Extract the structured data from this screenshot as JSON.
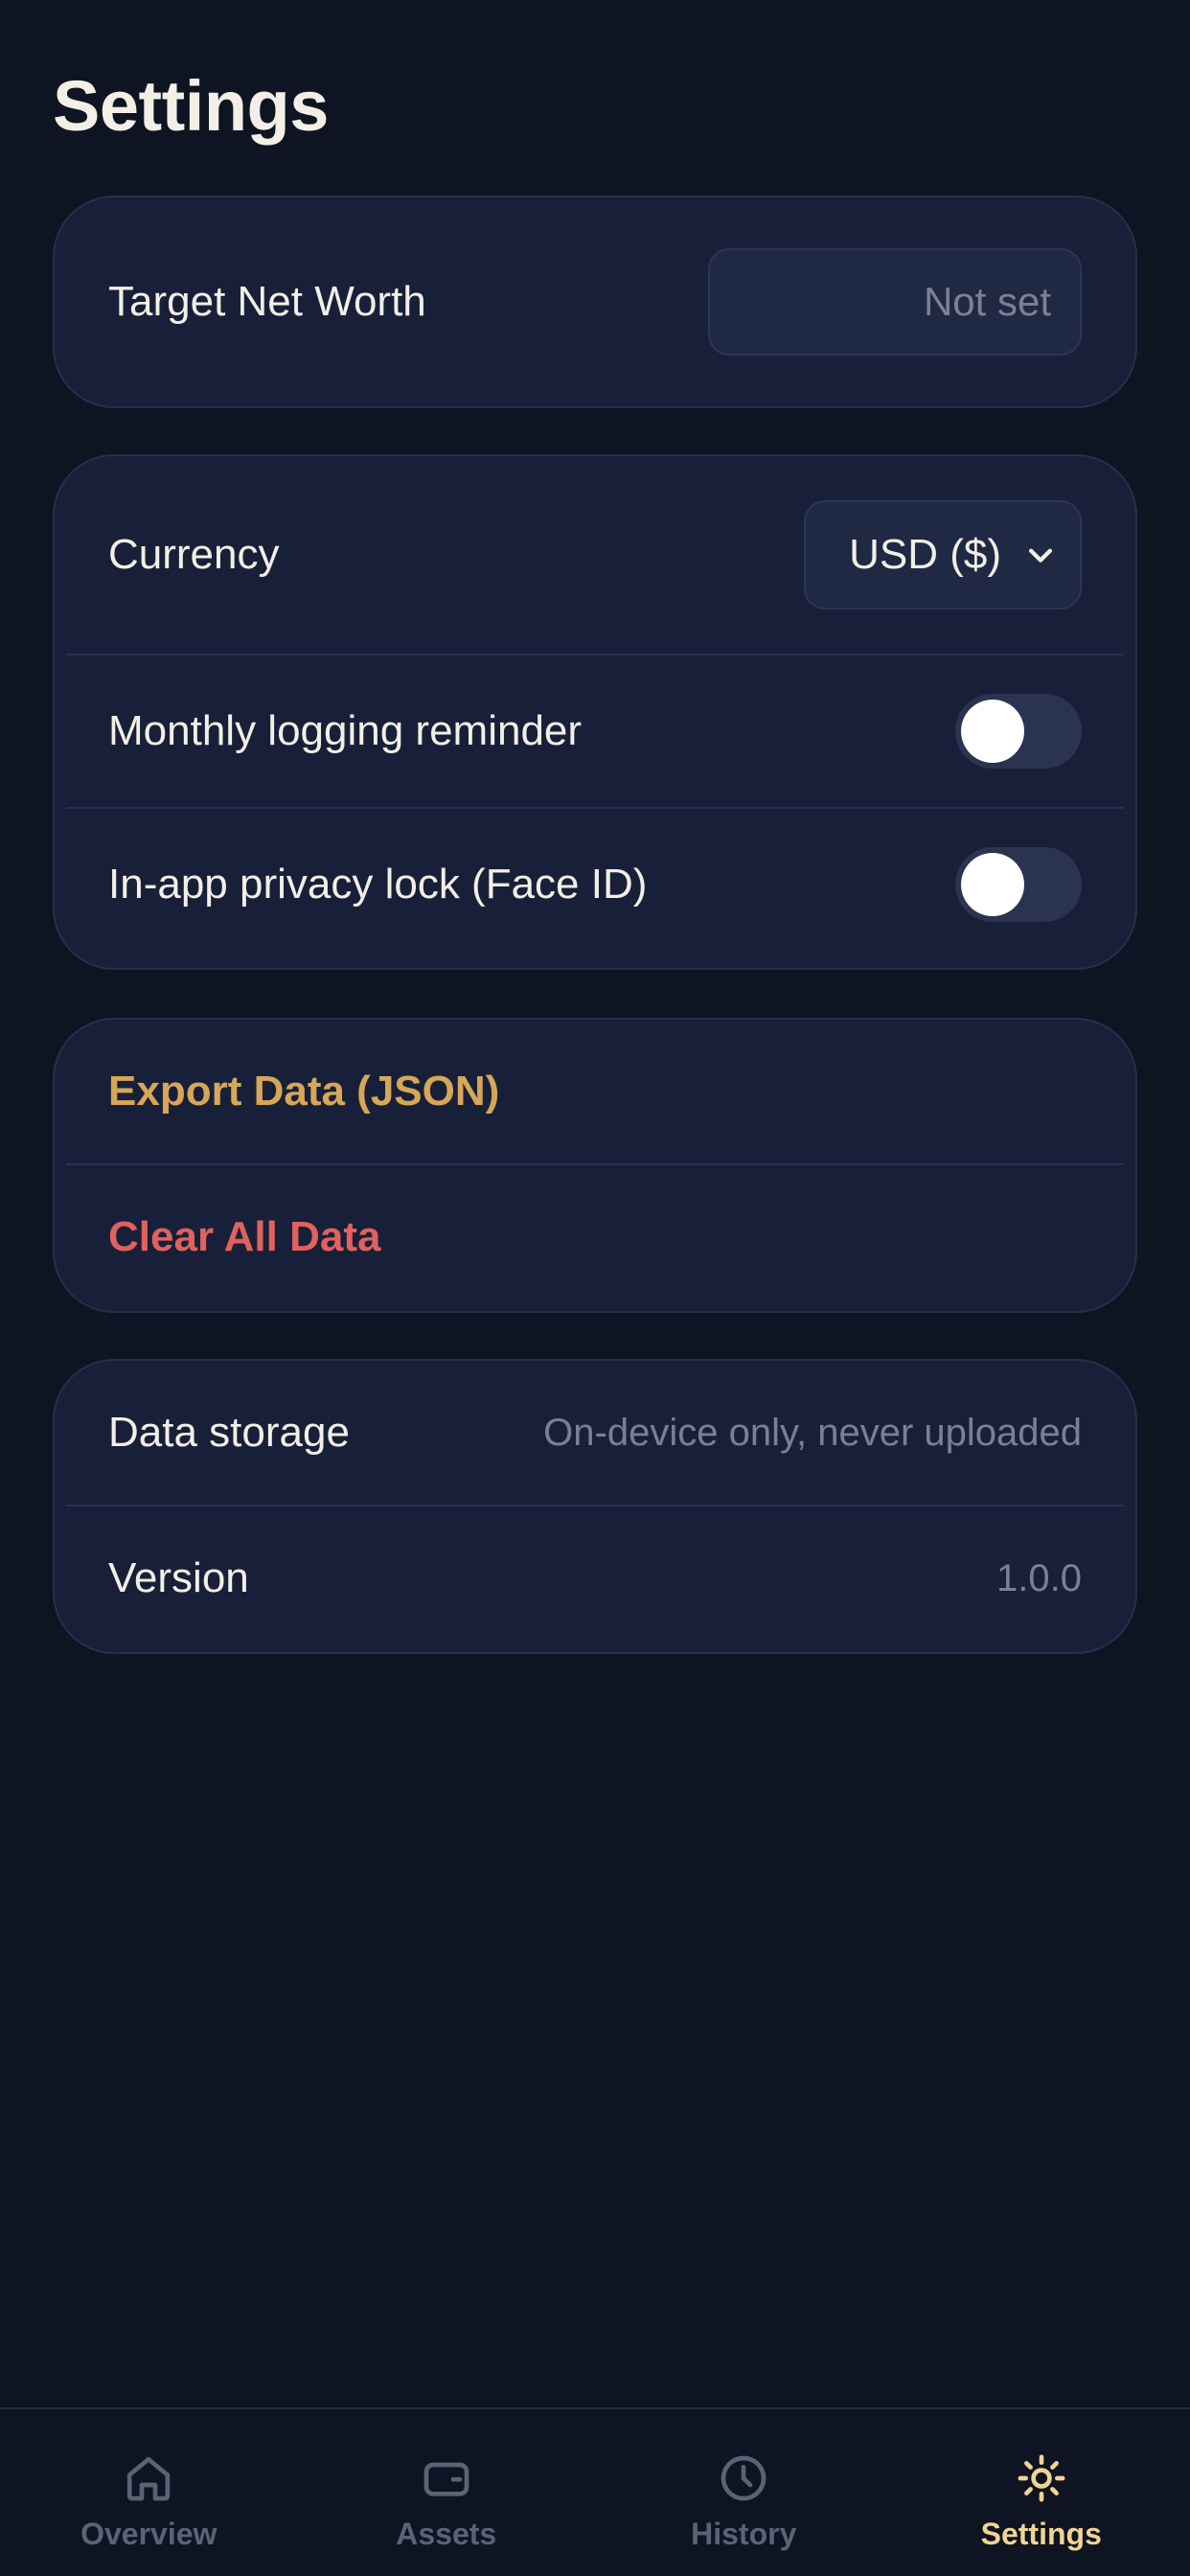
{
  "header": {
    "title": "Settings"
  },
  "target": {
    "label": "Target Net Worth",
    "value": "",
    "placeholder": "Not set"
  },
  "preferences": {
    "currency_label": "Currency",
    "currency_value": "USD ($)",
    "reminder_label": "Monthly logging reminder",
    "reminder_on": false,
    "privacy_label": "In-app privacy lock (Face ID)",
    "privacy_on": false
  },
  "actions": {
    "export_label": "Export Data (JSON)",
    "clear_label": "Clear All Data"
  },
  "info": {
    "storage_label": "Data storage",
    "storage_value": "On-device only, never uploaded",
    "version_label": "Version",
    "version_value": "1.0.0"
  },
  "tabbar": {
    "active": "Settings",
    "items": [
      {
        "label": "Overview",
        "icon": "home-icon"
      },
      {
        "label": "Assets",
        "icon": "wallet-icon"
      },
      {
        "label": "History",
        "icon": "clock-icon"
      },
      {
        "label": "Settings",
        "icon": "sun-gear-icon"
      }
    ]
  },
  "colors": {
    "background": "#0f1422",
    "card": "#182039",
    "accent_gold": "#d7a657",
    "danger": "#e0615d",
    "tab_active": "#f0d592",
    "tab_inactive": "#5b6276"
  }
}
